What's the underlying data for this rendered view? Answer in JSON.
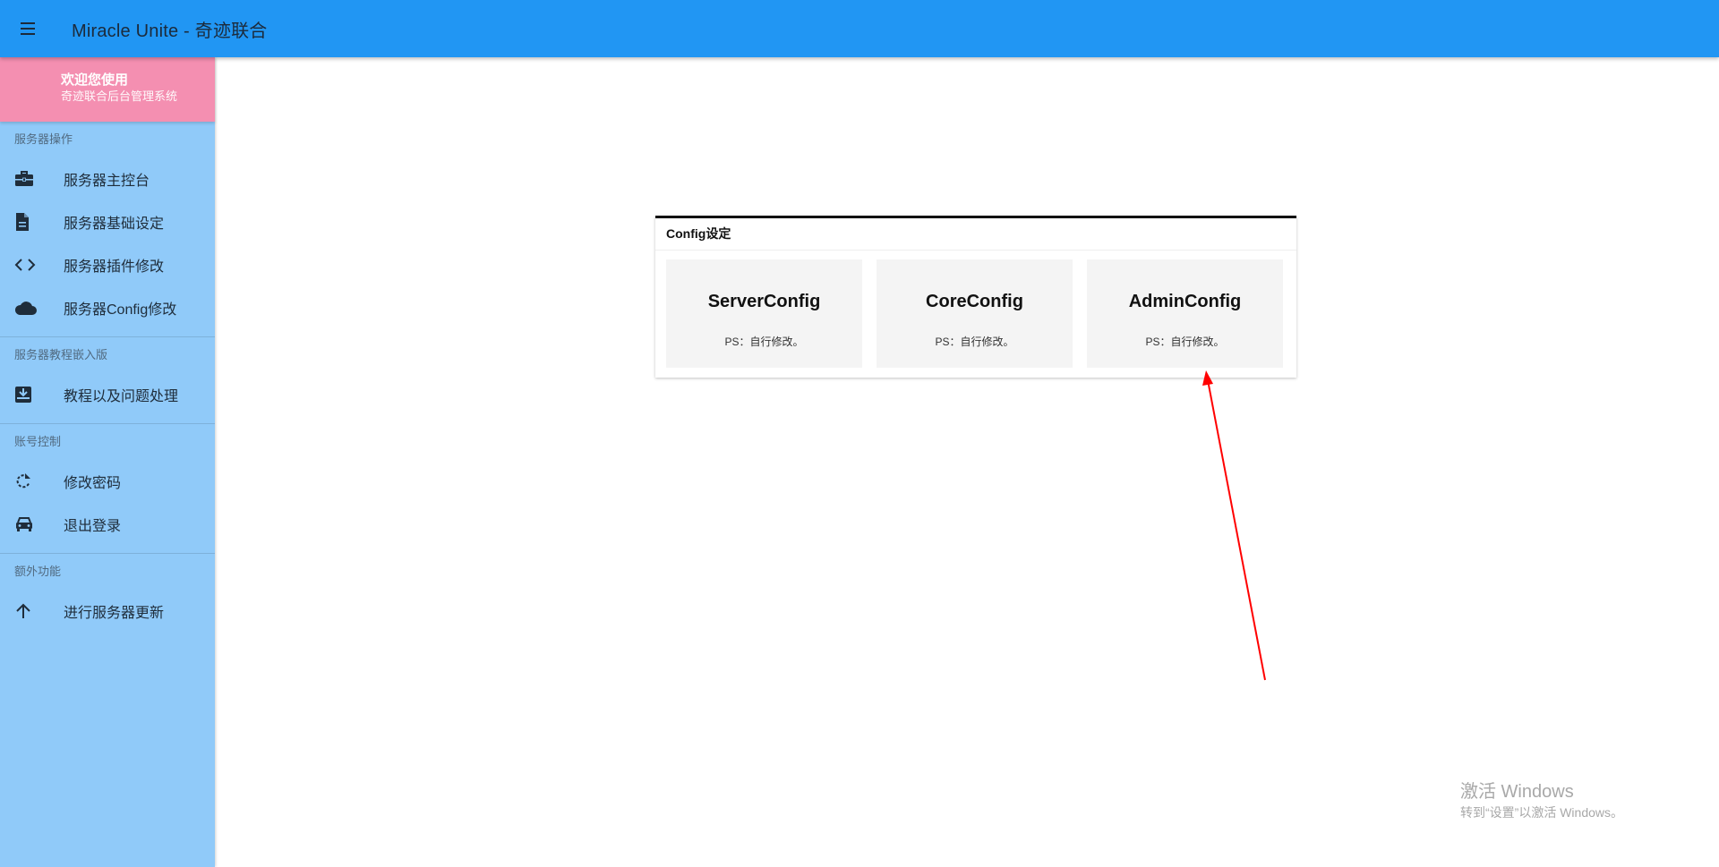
{
  "header": {
    "title": "Miracle Unite - 奇迹联合",
    "menu_icon": "hamburger-menu-icon"
  },
  "sidebar": {
    "welcome": {
      "line1": "欢迎您使用",
      "line2": "奇迹联合后台管理系统"
    },
    "sections": [
      {
        "title": "服务器操作",
        "items": [
          {
            "label": "服务器主控台",
            "icon": "briefcase-icon"
          },
          {
            "label": "服务器基础设定",
            "icon": "document-icon"
          },
          {
            "label": "服务器插件修改",
            "icon": "code-icon"
          },
          {
            "label": "服务器Config修改",
            "icon": "cloud-icon"
          }
        ]
      },
      {
        "title": "服务器教程嵌入版",
        "items": [
          {
            "label": "教程以及问题处理",
            "icon": "inbox-icon"
          }
        ]
      },
      {
        "title": "账号控制",
        "items": [
          {
            "label": "修改密码",
            "icon": "refresh-icon"
          },
          {
            "label": "退出登录",
            "icon": "car-icon"
          }
        ]
      },
      {
        "title": "额外功能",
        "items": [
          {
            "label": "进行服务器更新",
            "icon": "arrow-up-icon"
          }
        ]
      }
    ]
  },
  "main": {
    "card_title": "Config设定",
    "tiles": [
      {
        "title": "ServerConfig",
        "subtitle": "PS：自行修改。"
      },
      {
        "title": "CoreConfig",
        "subtitle": "PS：自行修改。"
      },
      {
        "title": "AdminConfig",
        "subtitle": "PS：自行修改。"
      }
    ]
  },
  "watermark": {
    "line1": "激活 Windows",
    "line2": "转到“设置”以激活 Windows。"
  },
  "colors": {
    "topbar": "#2196f3",
    "sidebar": "#90caf9",
    "welcome": "#f48fb1",
    "annotation": "#ff0000"
  }
}
